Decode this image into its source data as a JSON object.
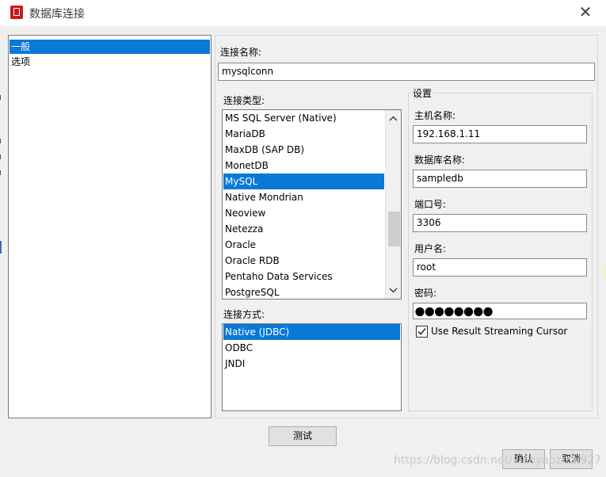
{
  "window": {
    "title": "数据库连接",
    "close_glyph": "✕"
  },
  "nav": {
    "items": [
      {
        "label": "一般",
        "selected": true
      },
      {
        "label": "选项",
        "selected": false
      }
    ]
  },
  "form": {
    "connection_name_label": "连接名称:",
    "connection_name_value": "mysqlconn",
    "connection_type_label": "连接类型:",
    "connection_types": [
      "MS SQL Server (Native)",
      "MariaDB",
      "MaxDB (SAP DB)",
      "MonetDB",
      "MySQL",
      "Native Mondrian",
      "Neoview",
      "Netezza",
      "Oracle",
      "Oracle RDB",
      "Pentaho Data Services",
      "PostgreSQL"
    ],
    "connection_type_selected": "MySQL",
    "access_label": "连接方式:",
    "access_methods": [
      "Native (JDBC)",
      "ODBC",
      "JNDI"
    ],
    "access_selected": "Native (JDBC)"
  },
  "settings": {
    "group_title": "设置",
    "host_label": "主机名称:",
    "host_value": "192.168.1.11",
    "db_label": "数据库名称:",
    "db_value": "sampledb",
    "port_label": "端口号:",
    "port_value": "3306",
    "user_label": "用户名:",
    "user_value": "root",
    "password_label": "密码:",
    "password_mask_count": 8,
    "streaming_label": "Use Result Streaming Cursor",
    "streaming_checked": true
  },
  "buttons": {
    "test": "测试",
    "ok": "确认",
    "cancel": "取消"
  },
  "watermark": "https://blog.csdn.net/xiaoyaozizai927",
  "colors": {
    "selection": "#0a78d7",
    "app_icon": "#c8191d"
  },
  "icons": {
    "app": "pentaho-connection-icon",
    "close": "close-icon",
    "scroll_up": "chevron-up-icon",
    "scroll_down": "chevron-down-icon",
    "check": "check-icon"
  }
}
